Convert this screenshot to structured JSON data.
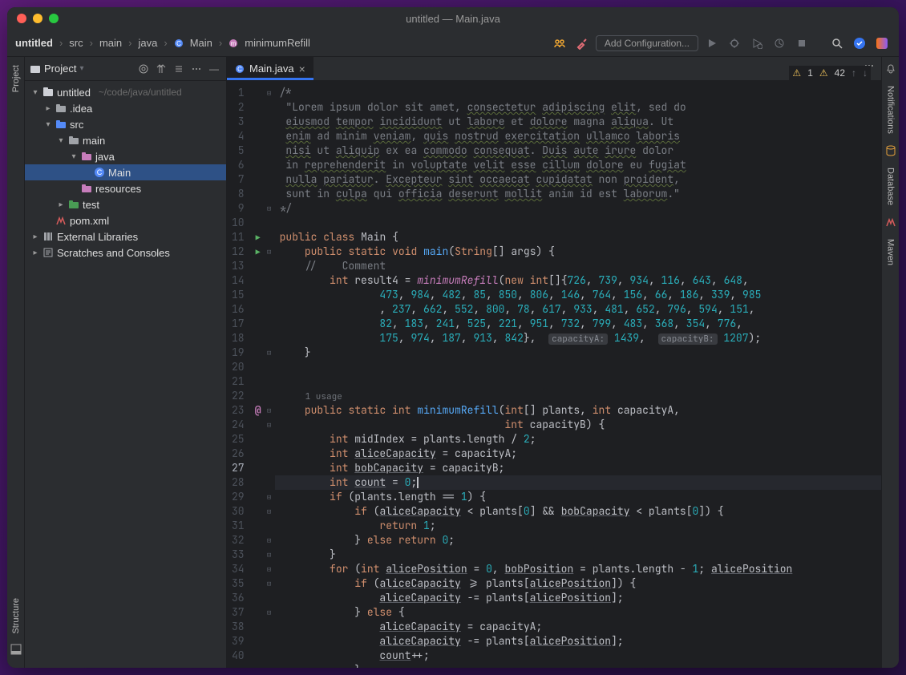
{
  "window_title": "untitled — Main.java",
  "breadcrumbs": [
    "untitled",
    "src",
    "main",
    "java",
    "Main",
    "minimumRefill"
  ],
  "add_configuration": "Add Configuration...",
  "left_tabs": {
    "project": "Project",
    "structure": "Structure"
  },
  "right_tabs": {
    "notifications": "Notifications",
    "database": "Database",
    "maven": "Maven"
  },
  "project_panel": {
    "title": "Project",
    "items": [
      {
        "depth": 0,
        "exp": "▾",
        "type": "proj",
        "label": "untitled",
        "hint": "~/code/java/untitled"
      },
      {
        "depth": 1,
        "exp": "▸",
        "type": "folder",
        "label": ".idea"
      },
      {
        "depth": 1,
        "exp": "▾",
        "type": "srcfolder",
        "label": "src"
      },
      {
        "depth": 2,
        "exp": "▾",
        "type": "folder",
        "label": "main"
      },
      {
        "depth": 3,
        "exp": "▾",
        "type": "pkg",
        "label": "java"
      },
      {
        "depth": 4,
        "exp": "",
        "type": "class",
        "label": "Main",
        "sel": true
      },
      {
        "depth": 3,
        "exp": "",
        "type": "res",
        "label": "resources"
      },
      {
        "depth": 2,
        "exp": "▸",
        "type": "test",
        "label": "test"
      },
      {
        "depth": 1,
        "exp": "",
        "type": "mvn",
        "label": "pom.xml"
      },
      {
        "depth": 0,
        "exp": "▸",
        "type": "lib",
        "label": "External Libraries"
      },
      {
        "depth": 0,
        "exp": "▸",
        "type": "scratch",
        "label": "Scratches and Consoles"
      }
    ]
  },
  "editor_tab": {
    "label": "Main.java"
  },
  "usage_hint": "1 usage",
  "param_hints": {
    "capA": "capacityA:",
    "capB": "capacityB:"
  },
  "inspections": {
    "warn1_count": "1",
    "warn2_count": "42"
  },
  "current_line": 27,
  "code_lines": [
    {
      "n": 1,
      "fold": "⊟",
      "html": "<span class='cm'>/*</span>"
    },
    {
      "n": 2,
      "html": " <span class='cm'>\"Lorem ipsum dolor sit amet, <span class='wavy'>consectetur</span> <span class='wavy'>adipiscing</span> <span class='wavy'>elit</span>, sed do</span>"
    },
    {
      "n": 3,
      "html": " <span class='cm'><span class='wavy'>eiusmod</span> <span class='wavy'>tempor</span> <span class='wavy'>incididunt</span> ut <span class='wavy'>labore</span> et <span class='wavy'>dolore</span> magna <span class='wavy'>aliqua</span>. Ut</span>"
    },
    {
      "n": 4,
      "html": " <span class='cm'><span class='wavy'>enim</span> ad minim <span class='wavy'>veniam</span>, <span class='wavy'>quis</span> <span class='wavy'>nostrud</span> <span class='wavy'>exercitation</span> <span class='wavy'>ullamco</span> <span class='wavy'>laboris</span></span>"
    },
    {
      "n": 5,
      "html": " <span class='cm'><span class='wavy'>nisi</span> ut <span class='wavy'>aliquip</span> ex ea <span class='wavy'>commodo</span> <span class='wavy'>consequat</span>. <span class='wavy'>Duis</span> <span class='wavy'>aute</span> <span class='wavy'>irure</span> dolor</span>"
    },
    {
      "n": 6,
      "html": " <span class='cm'>in <span class='wavy'>reprehenderit</span> in <span class='wavy'>voluptate</span> <span class='wavy'>velit</span> <span class='wavy'>esse</span> <span class='wavy'>cillum</span> <span class='wavy'>dolore</span> eu <span class='wavy'>fugiat</span></span>"
    },
    {
      "n": 7,
      "html": " <span class='cm'><span class='wavy'>nulla</span> <span class='wavy'>pariatur</span>. <span class='wavy'>Excepteur</span> <span class='wavy'>sint</span> <span class='wavy'>occaecat</span> <span class='wavy'>cupidatat</span> non <span class='wavy'>proident</span>,</span>"
    },
    {
      "n": 8,
      "html": " <span class='cm'>sunt in <span class='wavy'>culpa</span> qui <span class='wavy'>officia</span> <span class='wavy'>deserunt</span> <span class='wavy'>mollit</span> anim id est <span class='wavy'>laborum</span>.\"</span>"
    },
    {
      "n": 9,
      "fold": "⊟",
      "html": "<span class='cm'>*/</span>"
    },
    {
      "n": 10,
      "html": ""
    },
    {
      "n": 11,
      "mark": "run",
      "html": "<span class='kw'>public</span> <span class='kw'>class</span> <span class='cls'>Main</span> {"
    },
    {
      "n": 12,
      "mark": "run",
      "fold": "⊟",
      "html": "    <span class='kw'>public</span> <span class='kw'>static</span> <span class='kw'>void</span> <span class='mth'>main</span>(<span class='ty'>String</span>[] <span class='prm'>args</span>) {"
    },
    {
      "n": 13,
      "html": "    <span class='cm'>//    Comment</span>"
    },
    {
      "n": 14,
      "html": "        <span class='kw'>int</span> <span class='id'>result4</span> = <span class='fn'>minimumRefill</span>(<span class='kw'>new</span> <span class='kw'>int</span>[]{<span class='num'>726</span>, <span class='num'>739</span>, <span class='num'>934</span>, <span class='num'>116</span>, <span class='num'>643</span>, <span class='num'>648</span>,"
    },
    {
      "n": 15,
      "html": "                <span class='num'>473</span>, <span class='num'>984</span>, <span class='num'>482</span>, <span class='num'>85</span>, <span class='num'>850</span>, <span class='num'>806</span>, <span class='num'>146</span>, <span class='num'>764</span>, <span class='num'>156</span>, <span class='num'>66</span>, <span class='num'>186</span>, <span class='num'>339</span>, <span class='num'>985</span>"
    },
    {
      "n": 16,
      "html": "                , <span class='num'>237</span>, <span class='num'>662</span>, <span class='num'>552</span>, <span class='num'>800</span>, <span class='num'>78</span>, <span class='num'>617</span>, <span class='num'>933</span>, <span class='num'>481</span>, <span class='num'>652</span>, <span class='num'>796</span>, <span class='num'>594</span>, <span class='num'>151</span>,"
    },
    {
      "n": 17,
      "html": "                <span class='num'>82</span>, <span class='num'>183</span>, <span class='num'>241</span>, <span class='num'>525</span>, <span class='num'>221</span>, <span class='num'>951</span>, <span class='num'>732</span>, <span class='num'>799</span>, <span class='num'>483</span>, <span class='num'>368</span>, <span class='num'>354</span>, <span class='num'>776</span>,"
    },
    {
      "n": 18,
      "html": "                <span class='num'>175</span>, <span class='num'>974</span>, <span class='num'>187</span>, <span class='num'>913</span>, <span class='num'>842</span>},  <span class='hint'>capacityA:</span> <span class='num'>1439</span>,  <span class='hint'>capacityB:</span> <span class='num'>1207</span>);"
    },
    {
      "n": 19,
      "fold": "⊟",
      "html": "    }"
    },
    {
      "n": 20,
      "html": ""
    },
    {
      "n": 21,
      "html": ""
    },
    {
      "n": 0,
      "usage": true,
      "html": "<span class='usage'>1 usage</span>"
    },
    {
      "n": 22,
      "mark": "at",
      "fold": "⊟",
      "html": "    <span class='kw'>public</span> <span class='kw'>static</span> <span class='kw'>int</span> <span class='mth'>minimumRefill</span>(<span class='kw'>int</span>[] <span class='prm'>plants</span>, <span class='kw'>int</span> <span class='prm'>capacityA</span>,"
    },
    {
      "n": 23,
      "fold": "⊟",
      "html": "                                    <span class='kw'>int</span> <span class='prm'>capacityB</span>) {"
    },
    {
      "n": 24,
      "html": "        <span class='kw'>int</span> <span class='id'>midIndex</span> = <span class='id'>plants</span>.length / <span class='num'>2</span>;"
    },
    {
      "n": 25,
      "html": "        <span class='kw'>int</span> <span class='id under'>aliceCapacity</span> = <span class='id'>capacityA</span>;"
    },
    {
      "n": 26,
      "html": "        <span class='kw'>int</span> <span class='id under'>bobCapacity</span> = <span class='id'>capacityB</span>;"
    },
    {
      "n": 27,
      "hl": true,
      "html": "        <span class='kw'>int</span> <span class='id under'>count</span> = <span class='num'>0</span>;<span class='caret'></span>"
    },
    {
      "n": 28,
      "fold": "⊟",
      "html": "        <span class='kw'>if</span> (<span class='id'>plants</span>.length == <span class='num'>1</span>) {"
    },
    {
      "n": 29,
      "fold": "⊟",
      "html": "            <span class='kw'>if</span> (<span class='id under'>aliceCapacity</span> &lt; <span class='id'>plants</span>[<span class='num'>0</span>] &amp;&amp; <span class='id under'>bobCapacity</span> &lt; <span class='id'>plants</span>[<span class='num'>0</span>]) {"
    },
    {
      "n": 30,
      "html": "                <span class='kw'>return</span> <span class='num'>1</span>;"
    },
    {
      "n": 31,
      "fold": "⊟",
      "html": "            } <span class='kw'>else</span> <span class='kw'>return</span> <span class='num'>0</span>;"
    },
    {
      "n": 32,
      "fold": "⊟",
      "html": "        }"
    },
    {
      "n": 33,
      "fold": "⊟",
      "html": "        <span class='kw'>for</span> (<span class='kw'>int</span> <span class='id under'>alicePosition</span> = <span class='num'>0</span>, <span class='id under'>bobPosition</span> = <span class='id'>plants</span>.length - <span class='num'>1</span>; <span class='id under'>alicePosition</span>"
    },
    {
      "n": 34,
      "fold": "⊟",
      "html": "            <span class='kw'>if</span> (<span class='id under'>aliceCapacity</span> &gt;= <span class='id'>plants</span>[<span class='id under'>alicePosition</span>]) {"
    },
    {
      "n": 35,
      "html": "                <span class='id under'>aliceCapacity</span> -= <span class='id'>plants</span>[<span class='id under'>alicePosition</span>];"
    },
    {
      "n": 36,
      "fold": "⊟",
      "html": "            } <span class='kw'>else</span> {"
    },
    {
      "n": 37,
      "html": "                <span class='id under'>aliceCapacity</span> = <span class='id'>capacityA</span>;"
    },
    {
      "n": 38,
      "html": "                <span class='id under'>aliceCapacity</span> -= <span class='id'>plants</span>[<span class='id under'>alicePosition</span>];"
    },
    {
      "n": 39,
      "html": "                <span class='id under'>count</span>++;"
    },
    {
      "n": 40,
      "fold": "⊟",
      "html": "            }"
    }
  ]
}
